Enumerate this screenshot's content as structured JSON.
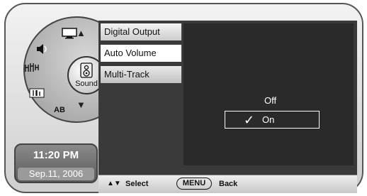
{
  "wheel": {
    "center_label": "Sound",
    "segments": [
      {
        "icon": "tv-icon"
      },
      {
        "icon": "speaker-icon"
      },
      {
        "icon": "antenna-icon"
      },
      {
        "icon": "input-icon"
      },
      {
        "label": "AB"
      }
    ],
    "up_arrow": "▲",
    "down_arrow": "▼"
  },
  "clock": {
    "time": "11:20 PM",
    "date": "Sep.11, 2006"
  },
  "menu": {
    "items": [
      {
        "label": "Digital Output"
      },
      {
        "label": "Auto Volume"
      },
      {
        "label": "Multi-Track"
      }
    ]
  },
  "options": {
    "off": "Off",
    "on": "On",
    "selected": "On",
    "check": "✓"
  },
  "footer": {
    "arrows": "▲▼",
    "select": "Select",
    "menu": "MENU",
    "back": "Back"
  }
}
